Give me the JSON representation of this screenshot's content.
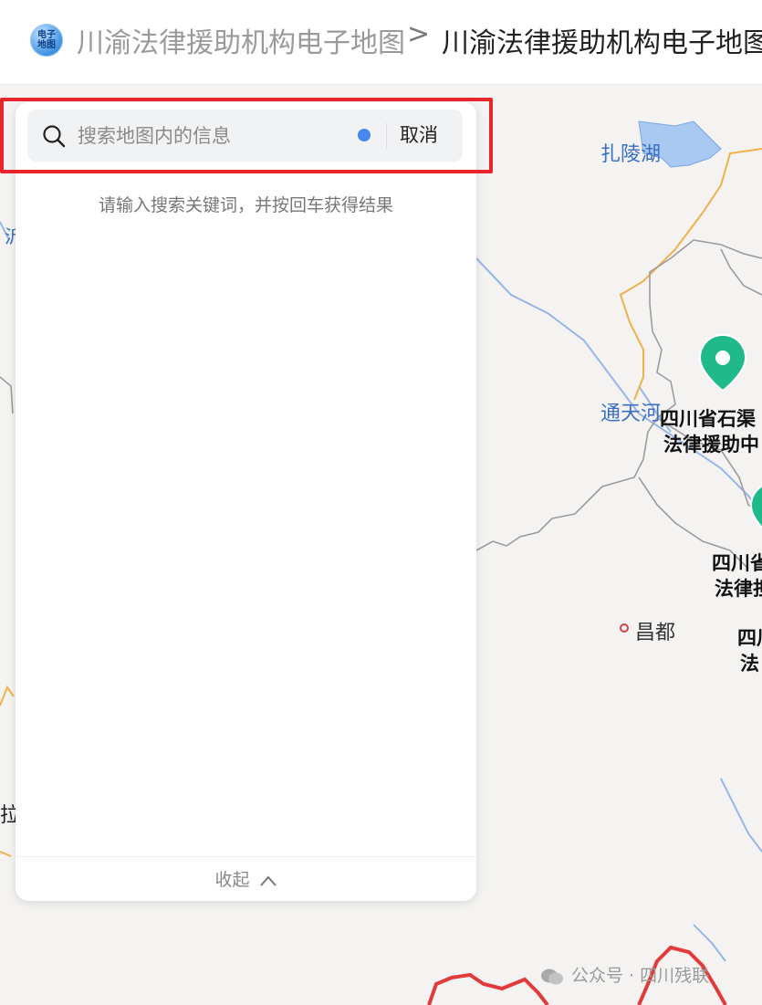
{
  "header": {
    "logo_text": "电子\n地图",
    "breadcrumb_parent": "川渝法律援助机构电子地图",
    "separator": ">",
    "breadcrumb_current": "川渝法律援助机构电子地图"
  },
  "search": {
    "placeholder": "搜索地图内的信息",
    "cancel_label": "取消",
    "hint": "请输入搜索关键词，并按回车获得结果",
    "collapse_label": "收起"
  },
  "map": {
    "lake_label": "扎陵湖",
    "river_label": "通天河",
    "poi_1_line1": "四川省石渠",
    "poi_1_line2": "法律援助中",
    "poi_2_line1": "四川省",
    "poi_2_line2": "法律担",
    "poi_3_line1": "四川",
    "poi_3_line2": "法",
    "city_label": "昌都",
    "edge_label_left": "沂",
    "edge_label_left2": "拉"
  },
  "watermark": "公众号 · 四川残联",
  "colors": {
    "highlight": "#e8252b",
    "marker": "#1fb98a",
    "accent_dot": "#4a86f0"
  }
}
